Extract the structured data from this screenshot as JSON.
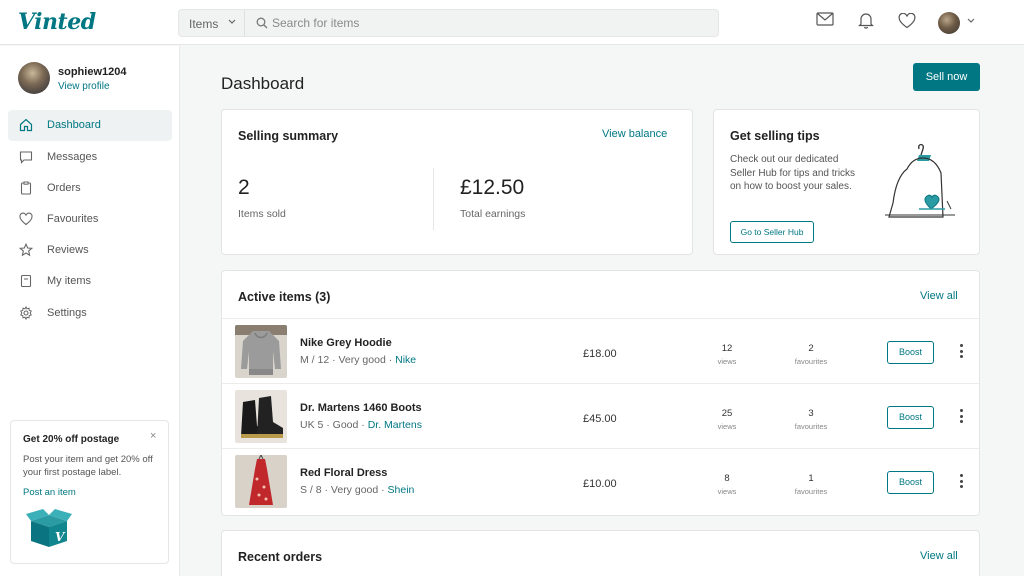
{
  "header": {
    "logo": "Vinted",
    "search_category": "Items",
    "search_placeholder": "Search for items",
    "icons": [
      "mail-icon",
      "bell-icon",
      "heart-icon"
    ]
  },
  "sidebar": {
    "username": "sophiew1204",
    "view_profile": "View profile",
    "items": [
      {
        "label": "Dashboard",
        "icon": "home-icon",
        "active": true
      },
      {
        "label": "Messages",
        "icon": "chat-icon",
        "active": false
      },
      {
        "label": "Orders",
        "icon": "clipboard-icon",
        "active": false
      },
      {
        "label": "Favourites",
        "icon": "heart-icon",
        "active": false
      },
      {
        "label": "Reviews",
        "icon": "star-icon",
        "active": false
      },
      {
        "label": "My items",
        "icon": "document-icon",
        "active": false
      },
      {
        "label": "Settings",
        "icon": "gear-icon",
        "active": false
      }
    ],
    "promo": {
      "title": "Get 20% off postage",
      "body": "Post your item and get 20% off your first postage label.",
      "link": "Post an item",
      "close": "×"
    }
  },
  "main": {
    "title": "Dashboard",
    "sell_now": "Sell now",
    "summary": {
      "title": "Selling summary",
      "link": "View balance",
      "items_sold": "2",
      "items_sold_label": "Items sold",
      "total_earnings": "£12.50",
      "total_earnings_label": "Total earnings"
    },
    "tips": {
      "title": "Get selling tips",
      "body": "Check out our dedicated Seller Hub for tips and tricks on how to boost your sales.",
      "button": "Go to Seller Hub"
    },
    "active_items": {
      "title": "Active items (3)",
      "view_all": "View all",
      "rows": [
        {
          "title": "Nike Grey Hoodie",
          "meta": "M / 12 · Very good · ",
          "brand": "Nike",
          "price": "£18.00",
          "views": "12",
          "views_label": "views",
          "favs": "2",
          "favs_label": "favourites",
          "boost": "Boost"
        },
        {
          "title": "Dr. Martens 1460 Boots",
          "meta": "UK 5 · Good · ",
          "brand": "Dr. Martens",
          "price": "£45.00",
          "views": "25",
          "views_label": "views",
          "favs": "3",
          "favs_label": "favourites",
          "boost": "Boost"
        },
        {
          "title": "Red Floral Dress",
          "meta": "S / 8 · Very good · ",
          "brand": "Shein",
          "price": "£10.00",
          "views": "8",
          "views_label": "views",
          "favs": "1",
          "favs_label": "favourites",
          "boost": "Boost"
        }
      ]
    },
    "recent_orders": {
      "title": "Recent orders",
      "view_all": "View all"
    }
  },
  "colors": {
    "brand": "#007782",
    "background": "#f5f6f6"
  }
}
